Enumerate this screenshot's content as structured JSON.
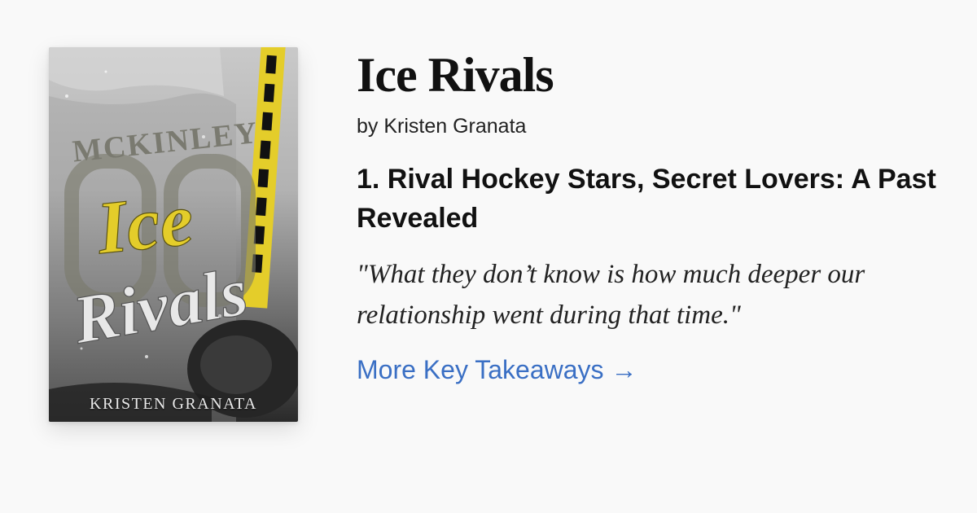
{
  "book": {
    "title": "Ice Rivals",
    "author_line": "by Kristen Granata",
    "cover": {
      "top_text": "MCKINLEY",
      "script_title_line1": "Ice",
      "script_title_line2": "Rivals",
      "author": "KRISTEN GRANATA",
      "accent_color": "#e4cd2a"
    }
  },
  "takeaway": {
    "title": "1. Rival Hockey Stars, Secret Lovers: A Past Revealed",
    "quote": "\"What they don’t know is how much deeper our relationship went during that time.\""
  },
  "link": {
    "label": "More Key Takeaways →",
    "color": "#3a6fc4"
  }
}
